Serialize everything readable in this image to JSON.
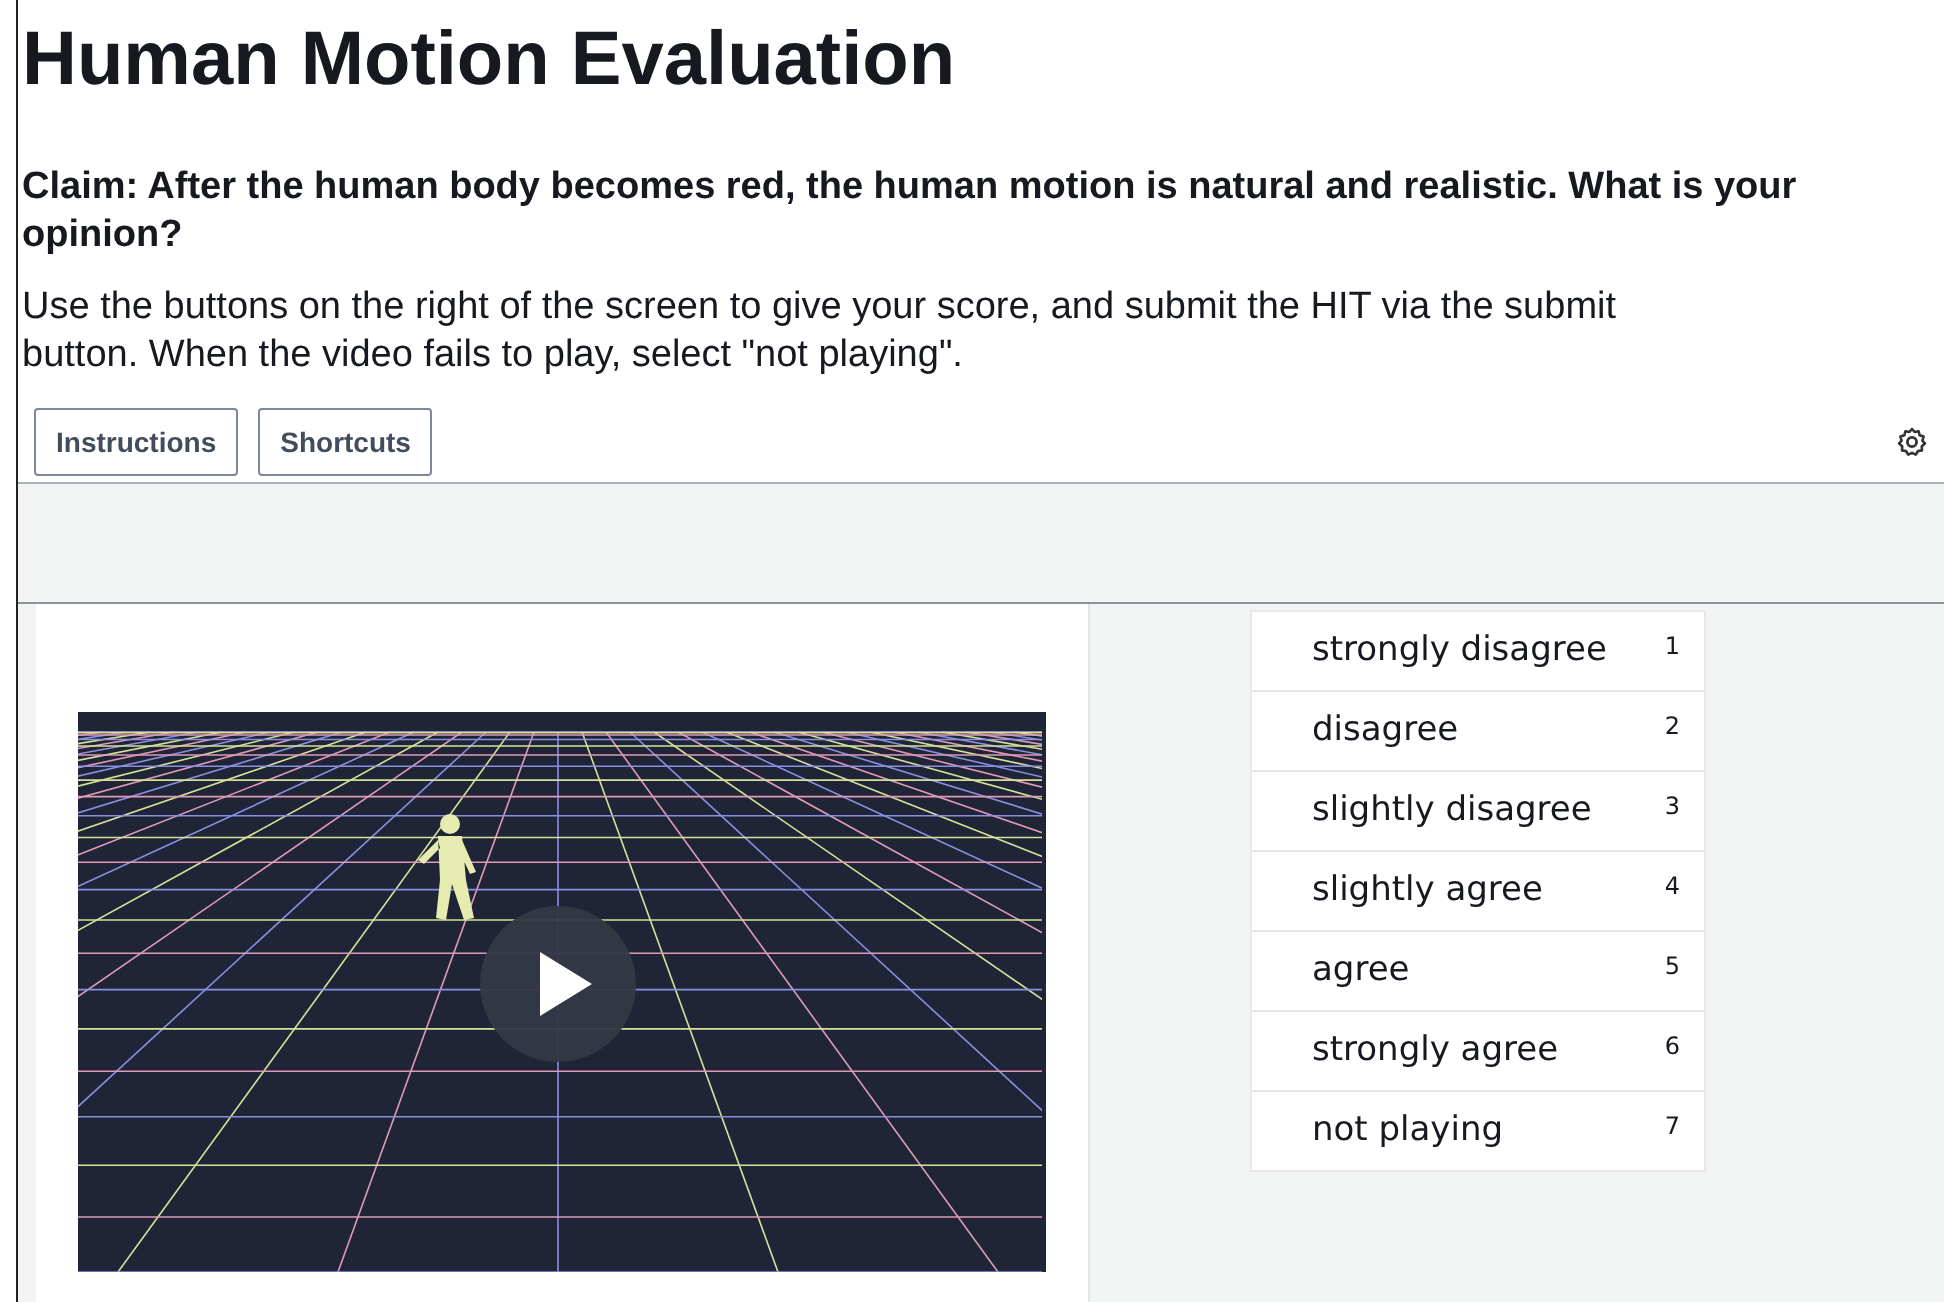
{
  "title": "Human Motion Evaluation",
  "claim": "Claim: After the human body becomes red, the human motion is natural and realistic. What is your opinion?",
  "instructions": "Use the buttons on the right of the screen to give your score, and submit the HIT via the submit button. When the video fails to play, select \"not playing\".",
  "toolbar": {
    "buttons": [
      "Instructions",
      "Shortcuts"
    ]
  },
  "options": [
    {
      "label": "strongly disagree",
      "key": "1"
    },
    {
      "label": "disagree",
      "key": "2"
    },
    {
      "label": "slightly disagree",
      "key": "3"
    },
    {
      "label": "slightly agree",
      "key": "4"
    },
    {
      "label": "agree",
      "key": "5"
    },
    {
      "label": "strongly agree",
      "key": "6"
    },
    {
      "label": "not playing",
      "key": "7"
    }
  ]
}
